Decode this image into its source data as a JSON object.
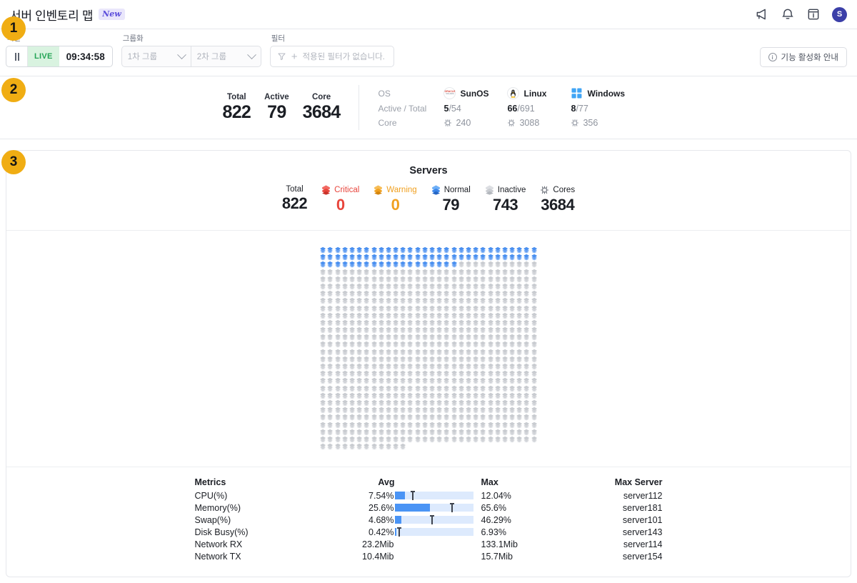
{
  "header": {
    "title": "서버 인벤토리 맵",
    "new_badge": "New",
    "icons": [
      {
        "name": "megaphone-icon",
        "label": "announcements"
      },
      {
        "name": "bell-icon",
        "label": "notifications"
      },
      {
        "name": "info-box-icon",
        "label": "guide"
      }
    ],
    "avatar_initial": "S"
  },
  "controls": {
    "time_label": "시간",
    "live_label": "LIVE",
    "time_value": "09:34:58",
    "group_label": "그룹화",
    "group_primary_placeholder": "1차 그룹",
    "group_secondary_placeholder": "2차 그룹",
    "filter_label": "필터",
    "filter_placeholder": "적용된 필터가 없습니다.",
    "info_button": "기능 활성화 안내"
  },
  "summary": {
    "kpis": [
      {
        "label": "Total",
        "value": "822"
      },
      {
        "label": "Active",
        "value": "79"
      },
      {
        "label": "Core",
        "value": "3684"
      }
    ],
    "row_labels": {
      "os": "OS",
      "active_total": "Active / Total",
      "core": "Core"
    },
    "os": [
      {
        "name": "SunOS",
        "icon": "oracle-logo-icon",
        "active": "5",
        "total": "/54",
        "core": "240"
      },
      {
        "name": "Linux",
        "icon": "tux-linux-icon",
        "active": "66",
        "total": "/691",
        "core": "3088"
      },
      {
        "name": "Windows",
        "icon": "windows-logo-icon",
        "active": "8",
        "total": "/77",
        "core": "356"
      }
    ]
  },
  "servers_card": {
    "title": "Servers",
    "legend": [
      {
        "label": "Total",
        "value": "822",
        "color": "#1b1e24",
        "icon": "none"
      },
      {
        "label": "Critical",
        "value": "0",
        "color": "#e8453c",
        "icon": "hex-critical-icon"
      },
      {
        "label": "Warning",
        "value": "0",
        "color": "#f0a020",
        "icon": "hex-warning-icon"
      },
      {
        "label": "Normal",
        "value": "79",
        "color": "#1b1e24",
        "icon": "hex-normal-icon"
      },
      {
        "label": "Inactive",
        "value": "743",
        "color": "#1b1e24",
        "icon": "hex-inactive-icon"
      },
      {
        "label": "Cores",
        "value": "3684",
        "color": "#1b1e24",
        "icon": "cpu-chip-icon"
      }
    ],
    "grid": {
      "columns": 30,
      "total": 822,
      "normal": 79,
      "inactive": 743,
      "normal_color": "#4a90f0",
      "inactive_color": "#c9ccd1"
    }
  },
  "metrics_table": {
    "columns": [
      "Metrics",
      "Avg",
      "Max",
      "Max Server"
    ],
    "rows": [
      {
        "metric": "CPU(%)",
        "avg": "7.54%",
        "max": "12.04%",
        "server": "server112",
        "fill_pct": 13,
        "mark_pct": 22
      },
      {
        "metric": "Memory(%)",
        "avg": "25.6%",
        "max": "65.6%",
        "server": "server181",
        "fill_pct": 45,
        "mark_pct": 72
      },
      {
        "metric": "Swap(%)",
        "avg": "4.68%",
        "max": "46.29%",
        "server": "server101",
        "fill_pct": 9,
        "mark_pct": 47
      },
      {
        "metric": "Disk Busy(%)",
        "avg": "0.42%",
        "max": "6.93%",
        "server": "server143",
        "fill_pct": 2,
        "mark_pct": 5
      },
      {
        "metric": "Network RX",
        "avg": "23.2Mib",
        "max": "133.1Mib",
        "server": "server114",
        "fill_pct": null,
        "mark_pct": null
      },
      {
        "metric": "Network TX",
        "avg": "10.4Mib",
        "max": "15.7Mib",
        "server": "server154",
        "fill_pct": null,
        "mark_pct": null
      }
    ]
  },
  "step_badges": [
    {
      "number": "1"
    },
    {
      "number": "2"
    },
    {
      "number": "3"
    }
  ]
}
